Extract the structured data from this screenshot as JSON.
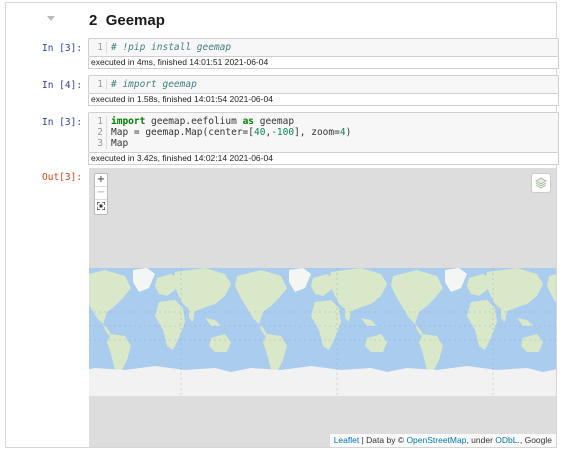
{
  "section": {
    "number": "2",
    "title": "Geemap"
  },
  "cells": [
    {
      "prompt": "In [3]:",
      "line_numbers": [
        "1"
      ],
      "code_lines": [
        "# !pip install geemap"
      ],
      "exec_status": "executed in 4ms, finished 14:01:51 2021-06-04"
    },
    {
      "prompt": "In [4]:",
      "line_numbers": [
        "1"
      ],
      "code_lines": [
        "# import geemap"
      ],
      "exec_status": "executed in 1.58s, finished 14:01:54 2021-06-04"
    },
    {
      "prompt": "In [3]:",
      "line_numbers": [
        "1",
        "2",
        "3"
      ],
      "code_lines": [
        "import geemap.eefolium as geemap",
        "Map = geemap.Map(center=[40,-100], zoom=4)",
        "Map"
      ],
      "exec_status": "executed in 3.42s, finished 14:02:14 2021-06-04"
    }
  ],
  "output": {
    "prompt": "Out[3]:",
    "map": {
      "zoom_in": "+",
      "zoom_out": "−",
      "fullscreen_icon": "fullscreen-icon",
      "layers_icon": "layers-icon",
      "attribution": {
        "leaflet": "Leaflet",
        "sep": " | Data by © ",
        "osm": "OpenStreetMap",
        "under": ", under ",
        "odbl": "ODbL",
        "rest": "., Google"
      },
      "colors": {
        "ocean": "#aacdef",
        "land": "#d9e8c8",
        "ice": "#f2f2f2",
        "background": "#dddddd"
      }
    }
  }
}
